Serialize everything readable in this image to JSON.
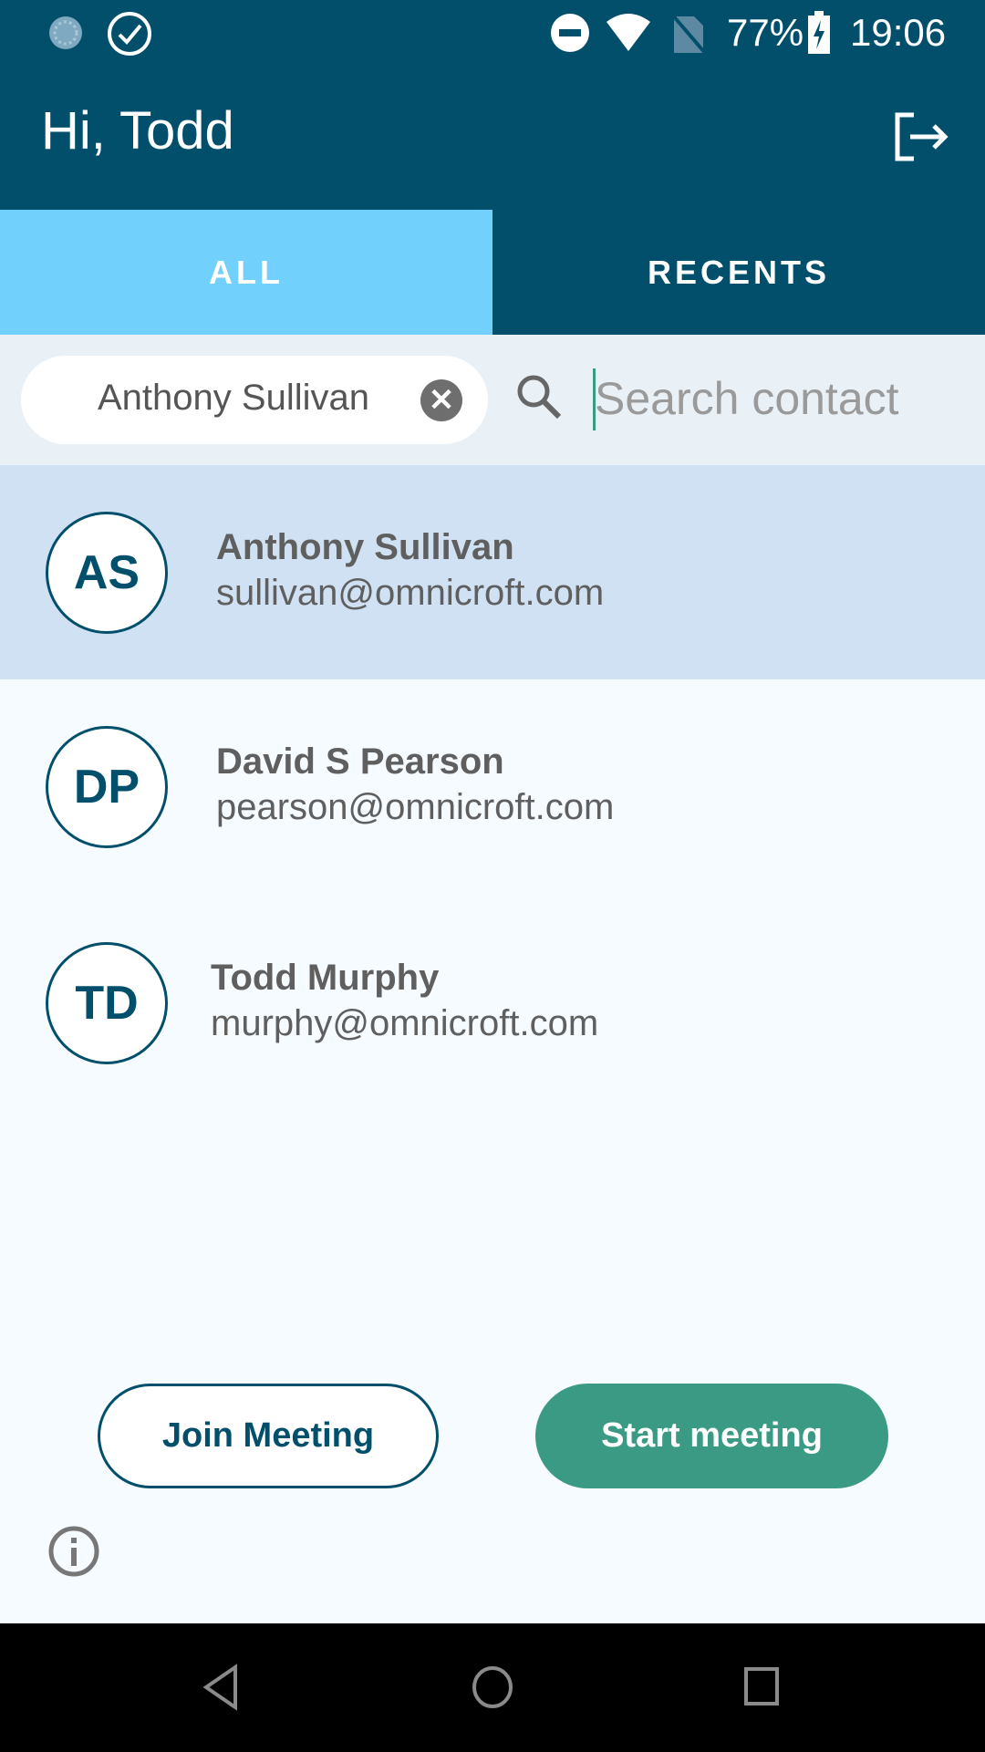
{
  "status_bar": {
    "battery": "77%",
    "time": "19:06",
    "icons": [
      "sync-icon",
      "check-circle-icon",
      "do-not-disturb-icon",
      "wifi-icon",
      "no-sim-icon",
      "battery-charging-icon"
    ]
  },
  "header": {
    "title": "Hi, Todd",
    "logout_icon": "logout-icon"
  },
  "tabs": [
    {
      "label": "ALL",
      "active": true
    },
    {
      "label": "RECENTS",
      "active": false
    }
  ],
  "search": {
    "chip": "Anthony Sullivan",
    "placeholder": "Search contact",
    "value": ""
  },
  "contacts": [
    {
      "initials": "AS",
      "name": "Anthony Sullivan",
      "email": "sullivan@omnicroft.com",
      "selected": true
    },
    {
      "initials": "DP",
      "name": "David S Pearson",
      "email": "pearson@omnicroft.com",
      "selected": false
    },
    {
      "initials": "TD",
      "name": "Todd Murphy",
      "email": "murphy@omnicroft.com",
      "selected": false
    }
  ],
  "buttons": {
    "join": "Join Meeting",
    "start": "Start meeting"
  },
  "colors": {
    "primary": "#014f6b",
    "tab_active": "#72d0fd",
    "accent": "#3a9a84",
    "selected_row": "#d0e1f3"
  }
}
